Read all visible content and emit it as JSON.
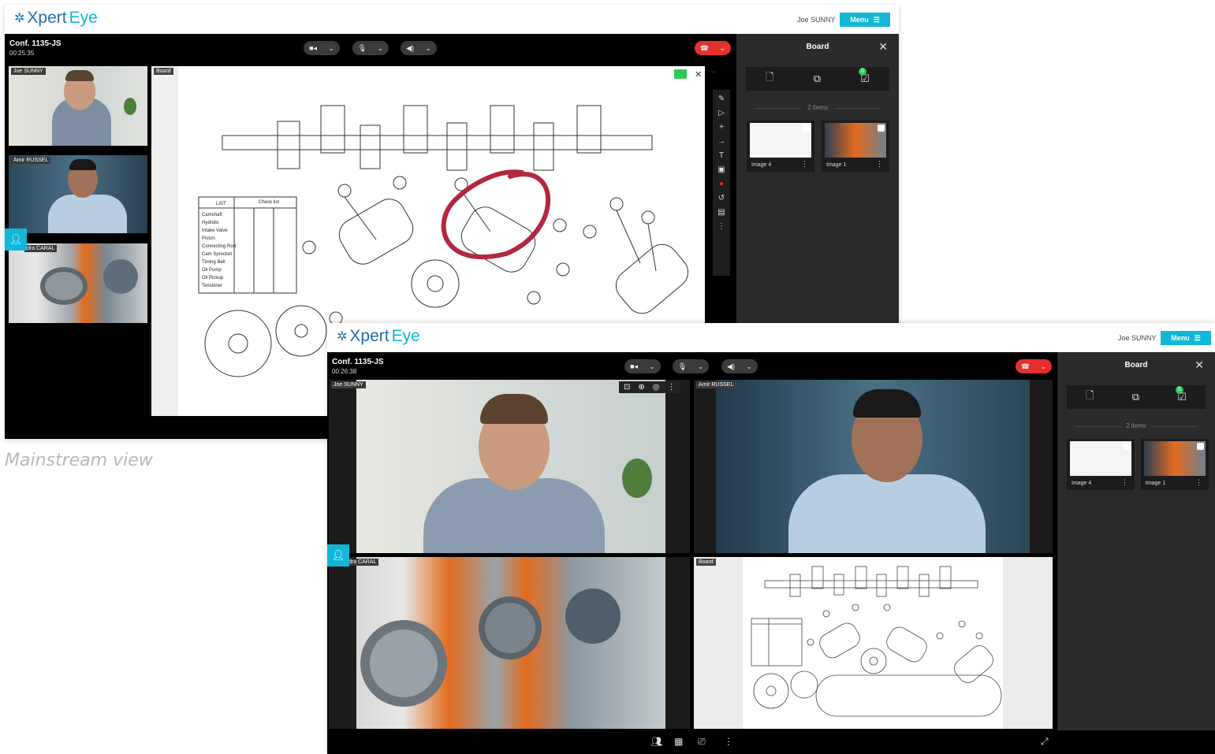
{
  "logo": {
    "prefix": "Xpert",
    "suffix": "Eye"
  },
  "user": {
    "name": "Joe SUNNY"
  },
  "menu": {
    "label": "Menu"
  },
  "top_view": {
    "conference": {
      "title": "Conf. 1135-JS",
      "time": "00:25:35"
    },
    "participants": [
      "Joe SUNNY",
      "Amir RUSSEL",
      "dra CARAL"
    ],
    "board_tile_label": "Board"
  },
  "bottom_view": {
    "conference": {
      "title": "Conf. 1135-JS",
      "time": "00:26:38"
    },
    "participants": [
      "Joe SUNNY",
      "Amir RUSSEL",
      "dra CARAL"
    ],
    "board_tile_label": "Board"
  },
  "board_panel": {
    "title": "Board",
    "badge": "0",
    "items_count": "2 items",
    "items": [
      {
        "label": "Image 4"
      },
      {
        "label": "Image 1"
      }
    ]
  },
  "checklist": {
    "header": [
      "LIST",
      "Check list"
    ],
    "rows": [
      "Camshaft",
      "Hydrolic",
      "Intake Valve",
      "Piston",
      "Connecting Rod",
      "Cam Sprocket",
      "Timing Belt",
      "Oil Pump",
      "Oil Pickup",
      "Tensioner"
    ]
  },
  "caption": "Mainstream view",
  "colors": {
    "accent": "#12b7d8",
    "hangup": "#e5312d",
    "panel": "#2b2b2b",
    "annotation": "#b3283e"
  }
}
